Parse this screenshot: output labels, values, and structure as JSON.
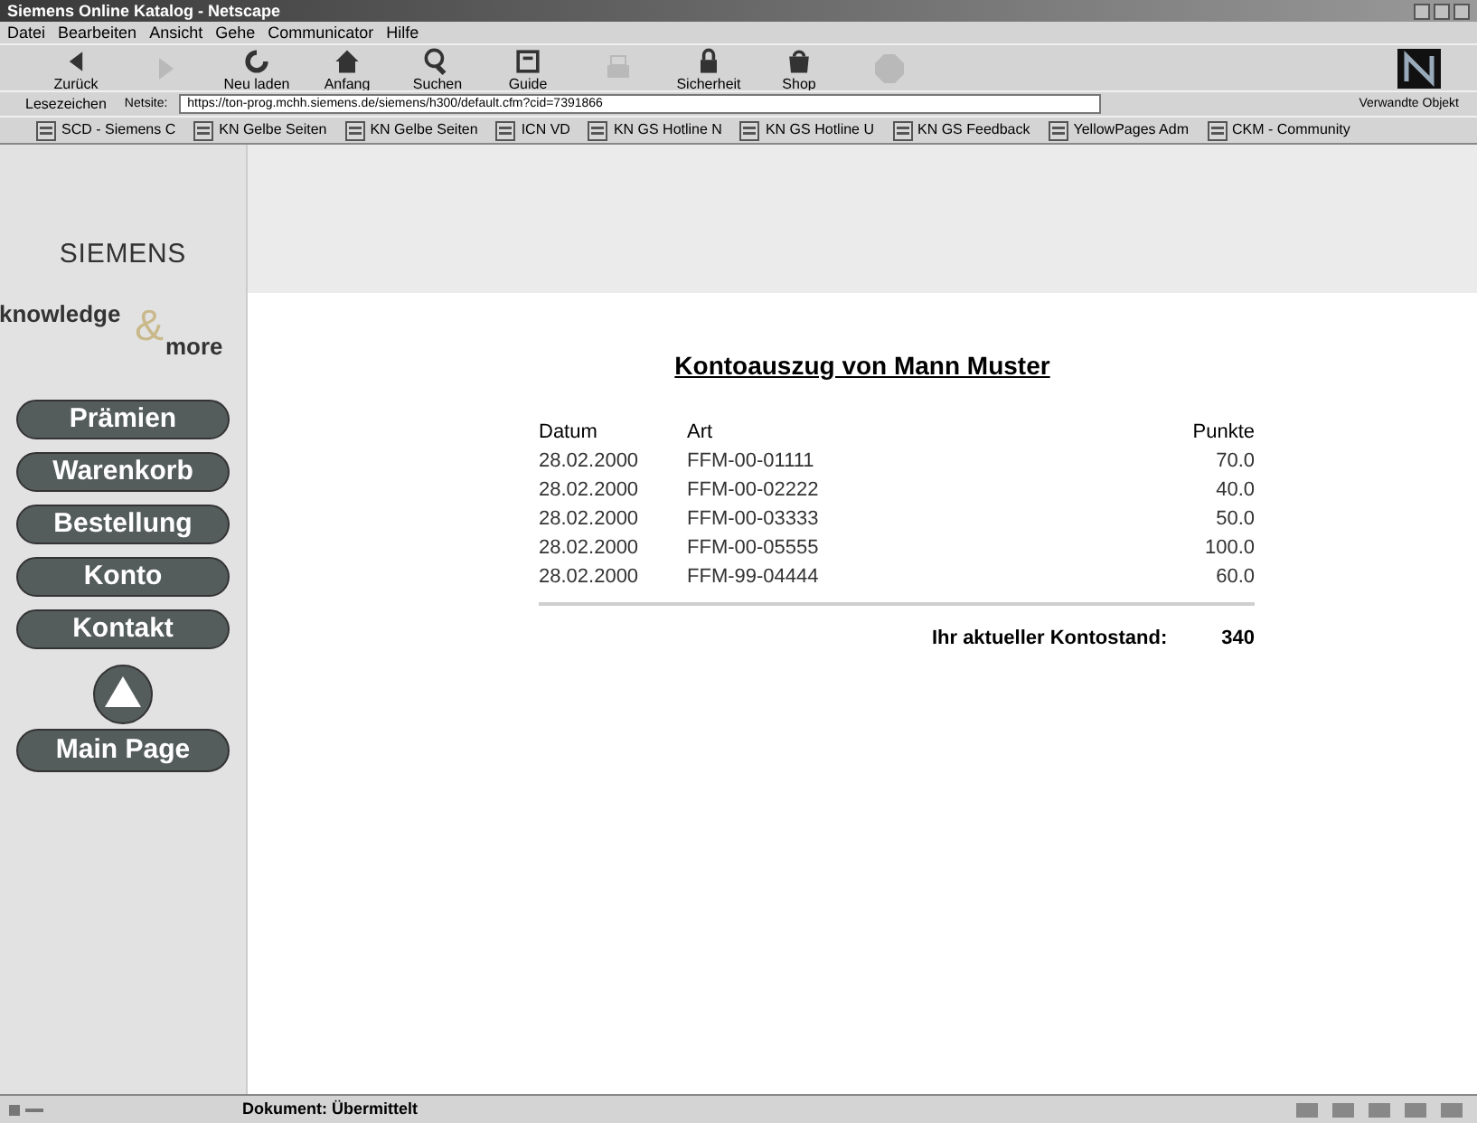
{
  "window": {
    "title": "Siemens Online Katalog - Netscape"
  },
  "menu": [
    "Datei",
    "Bearbeiten",
    "Ansicht",
    "Gehe",
    "Communicator",
    "Hilfe"
  ],
  "toolbar": [
    {
      "label": "Zurück",
      "disabled": false
    },
    {
      "disabled": true
    },
    {
      "label": "Neu laden",
      "disabled": false
    },
    {
      "label": "Anfang",
      "disabled": false
    },
    {
      "label": "Suchen",
      "disabled": false
    },
    {
      "label": "Guide",
      "disabled": false
    },
    {
      "disabled": true
    },
    {
      "label": "Sicherheit",
      "disabled": false
    },
    {
      "label": "Shop",
      "disabled": false
    },
    {
      "disabled": true
    }
  ],
  "location": {
    "bookmarks_label": "Lesezeichen",
    "field_label": "Netsite:",
    "url": "https://ton-prog.mchh.siemens.de/siemens/h300/default.cfm?cid=7391866",
    "related": "Verwandte Objekt"
  },
  "personal_toolbar": [
    "SCD - Siemens C",
    "KN Gelbe Seiten",
    "KN Gelbe Seiten",
    "ICN VD",
    "KN GS Hotline N",
    "KN GS Hotline U",
    "KN GS Feedback",
    "YellowPages Adm",
    "CKM - Community"
  ],
  "sidebar": {
    "brand": "SIEMENS",
    "logo_top": "knowledge",
    "logo_amp": "&",
    "logo_bottom": "more",
    "nav": [
      "Prämien",
      "Warenkorb",
      "Bestellung",
      "Konto",
      "Kontakt"
    ],
    "main_page": "Main Page"
  },
  "statement": {
    "title": "Kontoauszug von Mann Muster",
    "columns": [
      "Datum",
      "Art",
      "Punkte"
    ],
    "rows": [
      [
        "28.02.2000",
        "FFM-00-01111",
        "70.0"
      ],
      [
        "28.02.2000",
        "FFM-00-02222",
        "40.0"
      ],
      [
        "28.02.2000",
        "FFM-00-03333",
        "50.0"
      ],
      [
        "28.02.2000",
        "FFM-00-05555",
        "100.0"
      ],
      [
        "28.02.2000",
        "FFM-99-04444",
        "60.0"
      ]
    ],
    "total_label": "Ihr aktueller Kontostand:",
    "total": "340"
  },
  "status_bar": {
    "text": "Dokument: Übermittelt"
  }
}
